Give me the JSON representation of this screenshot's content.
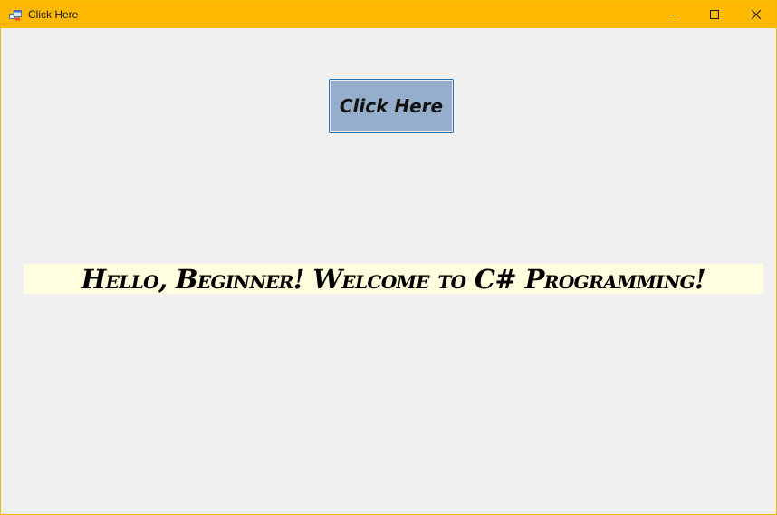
{
  "window": {
    "title": "Click Here",
    "icon": "winforms-app-icon",
    "accent_color": "#ffb900",
    "controls": {
      "minimize_icon": "minimize-icon",
      "maximize_icon": "maximize-icon",
      "close_icon": "close-icon"
    }
  },
  "form": {
    "background": "#f0f0f0",
    "button": {
      "label": "Click Here",
      "background": "#94aecc",
      "border_color": "#1f6fb3"
    },
    "label": {
      "text": "Hello, Beginner! Welcome to C# Programming!",
      "background": "#ffffe0"
    }
  }
}
